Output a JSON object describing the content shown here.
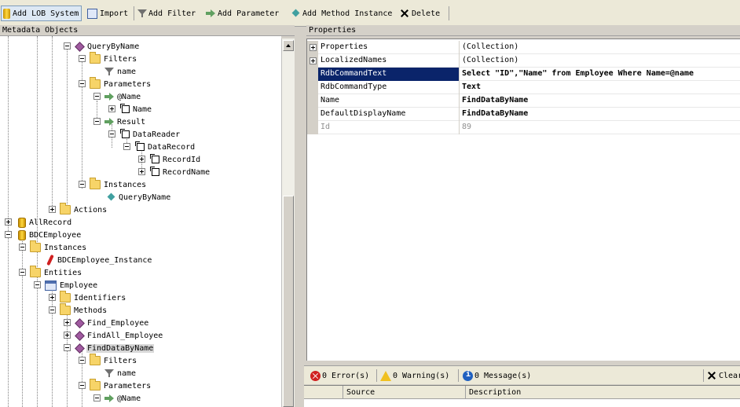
{
  "toolbar": {
    "add_lob_system": "Add LOB System",
    "import": "Import",
    "add_filter": "Add Filter",
    "add_parameter": "Add  Parameter",
    "add_method_instance": "Add Method Instance",
    "delete": "Delete"
  },
  "metadata_panel": {
    "title": "Metadata Objects"
  },
  "properties_panel": {
    "title": "Properties"
  },
  "tree": {
    "query_by_name": "QueryByName",
    "filters_1": "Filters",
    "name_filter_1": "name",
    "parameters_1": "Parameters",
    "param_name_1": "@Name",
    "name_type": "Name",
    "result": "Result",
    "data_reader": "DataReader",
    "data_record": "DataRecord",
    "record_id": "RecordId",
    "record_name": "RecordName",
    "instances_1": "Instances",
    "query_by_name_instance": "QueryByName",
    "actions": "Actions",
    "all_record": "AllRecord",
    "bdc_employee": "BDCEmployee",
    "instances_2": "Instances",
    "bdc_employee_instance": "BDCEmployee_Instance",
    "entities": "Entities",
    "employee": "Employee",
    "identifiers": "Identifiers",
    "methods": "Methods",
    "find_employee": "Find_Employee",
    "find_all_employee": "FindAll_Employee",
    "find_data_by_name": "FindDataByName",
    "filters_2": "Filters",
    "name_filter_2": "name",
    "parameters_2": "Parameters",
    "param_name_2": "@Name"
  },
  "properties": {
    "rows": [
      {
        "name": "Properties",
        "value": "(Collection)"
      },
      {
        "name": "LocalizedNames",
        "value": "(Collection)"
      },
      {
        "name": "RdbCommandText",
        "value": "Select \"ID\",\"Name\" from  Employee Where Name=@name"
      },
      {
        "name": "RdbCommandType",
        "value": "Text"
      },
      {
        "name": "Name",
        "value": "FindDataByName"
      },
      {
        "name": "DefaultDisplayName",
        "value": "FindDataByName"
      },
      {
        "name": "Id",
        "value": "89"
      }
    ]
  },
  "error_list": {
    "errors": "0 Error(s)",
    "warnings": "0 Warning(s)",
    "messages": "0 Message(s)",
    "clear": "Clear",
    "col_source": "Source",
    "col_description": "Description"
  },
  "colors": {
    "selection": "#0a246a",
    "panel": "#d4d0c8",
    "toolbar": "#ece9d8"
  }
}
